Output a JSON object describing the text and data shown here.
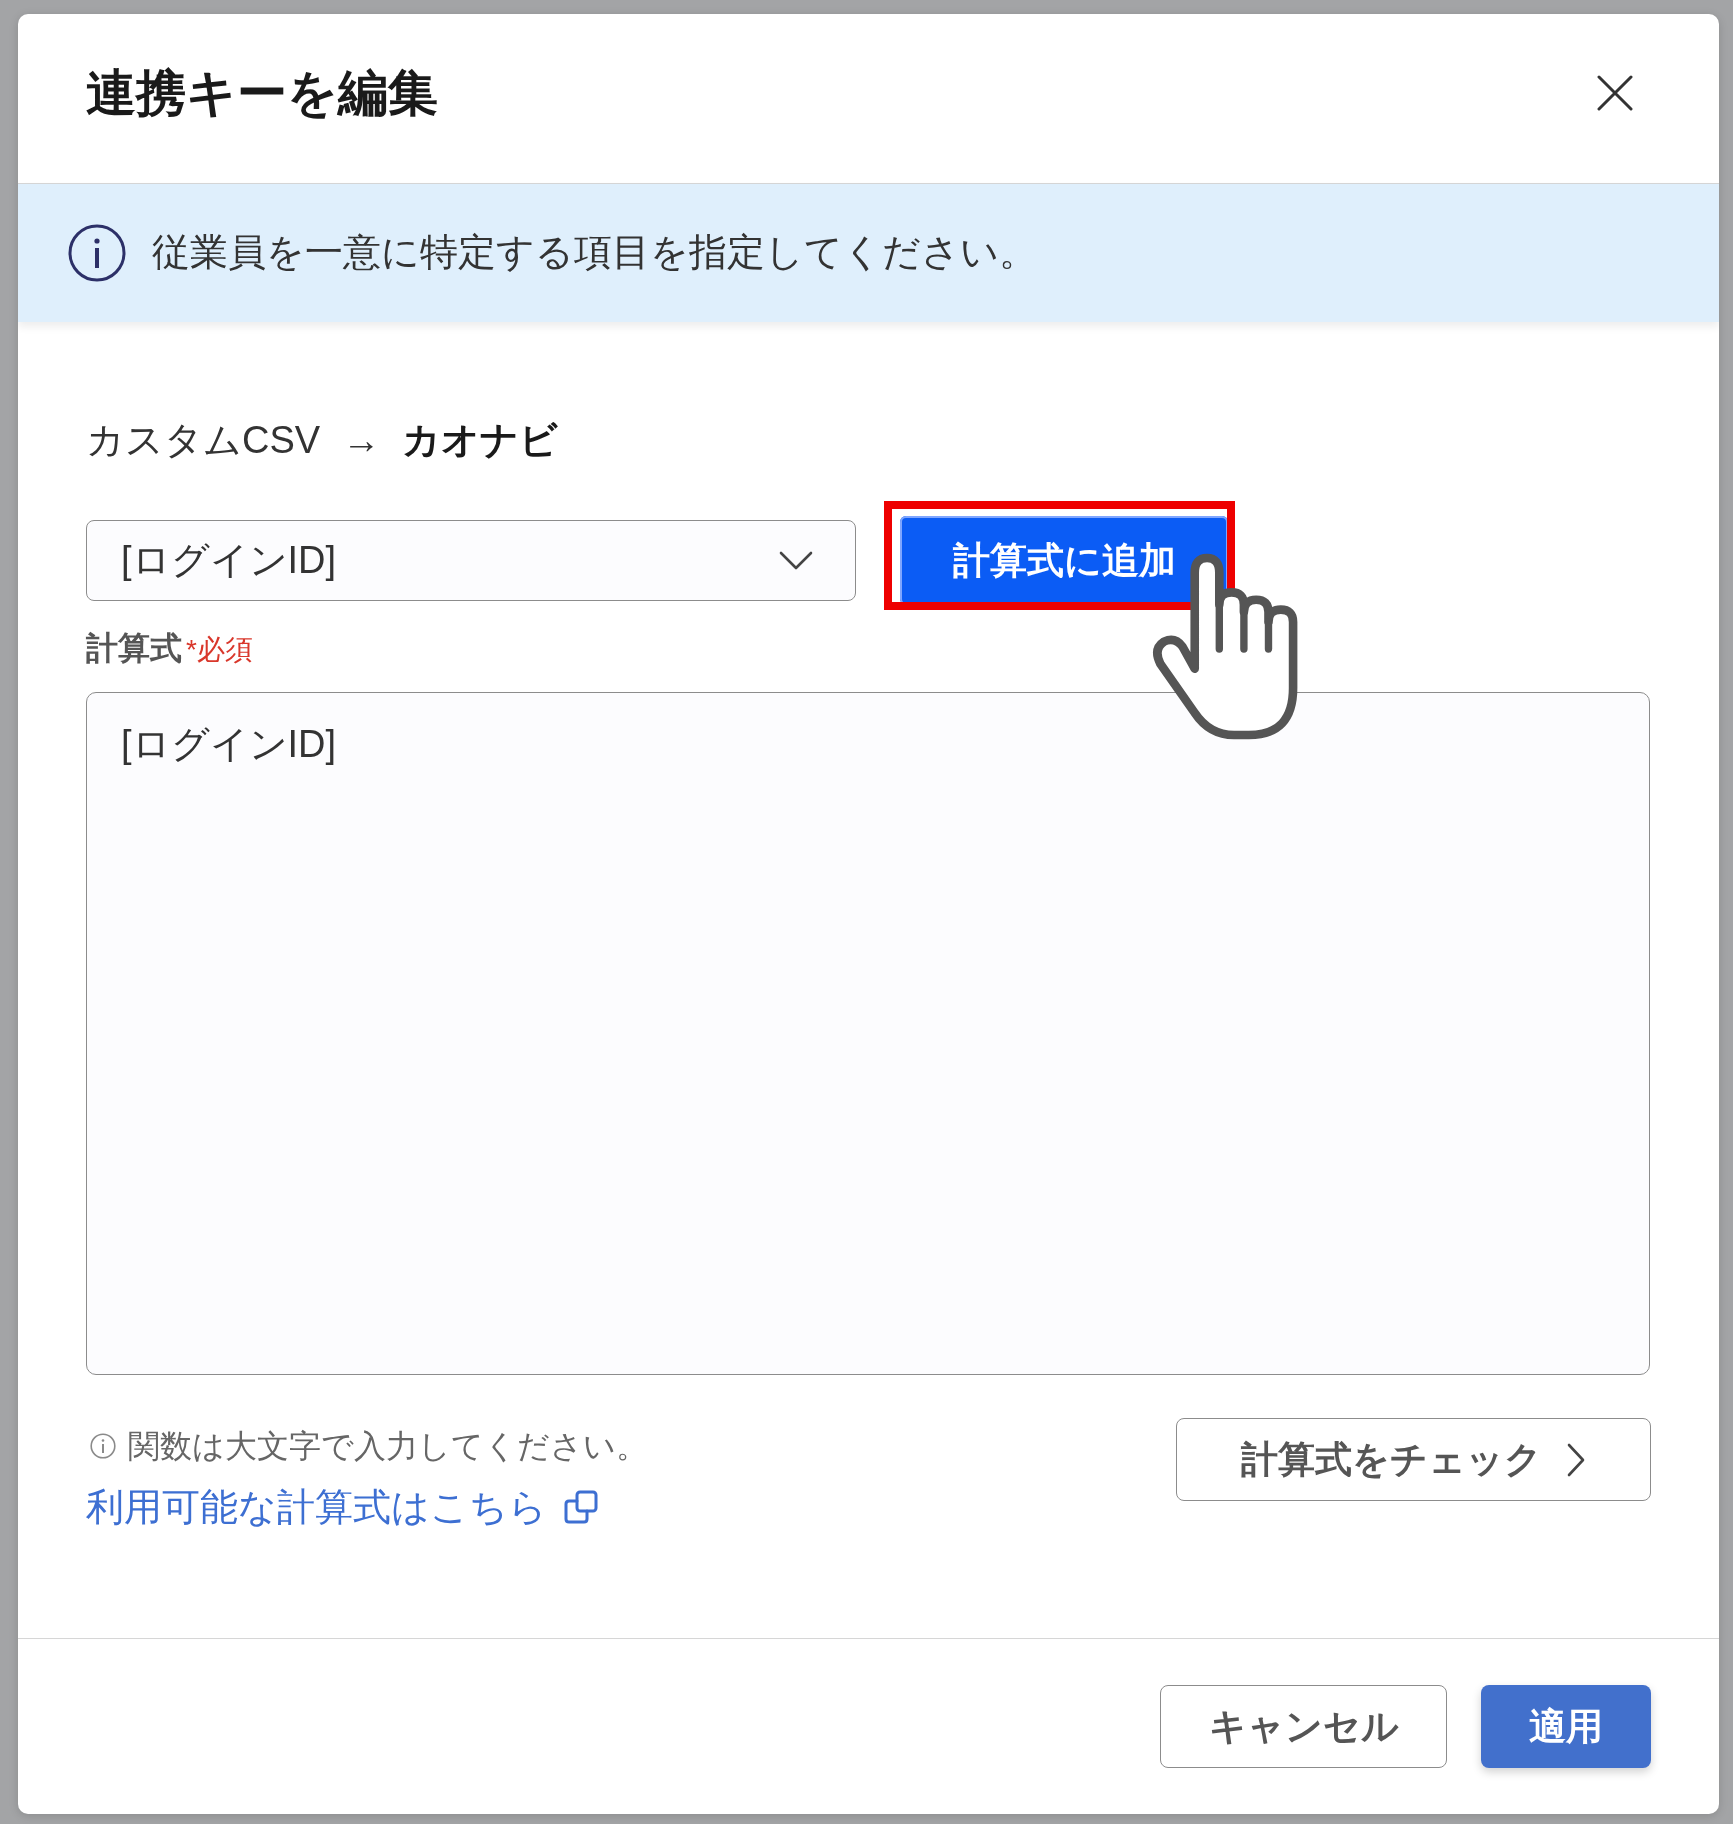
{
  "dialog": {
    "title": "連携キーを編集"
  },
  "notice": {
    "text": "従業員を一意に特定する項目を指定してください。"
  },
  "mapping": {
    "source": "カスタムCSV",
    "arrow": "→",
    "target": "カオナビ"
  },
  "field_select": {
    "value": "[ログインID]"
  },
  "add_button": {
    "label": "計算式に追加",
    "highlighted": true
  },
  "formula": {
    "label": "計算式",
    "required": "*必須",
    "value": "[ログインID]"
  },
  "hint": {
    "text": "関数は大文字で入力してください。"
  },
  "reference_link": {
    "label": "利用可能な計算式はこちら"
  },
  "check_button": {
    "label": "計算式をチェック"
  },
  "footer_buttons": [
    {
      "label": "キャンセル",
      "kind": "secondary"
    },
    {
      "label": "適用",
      "kind": "primary"
    }
  ]
}
